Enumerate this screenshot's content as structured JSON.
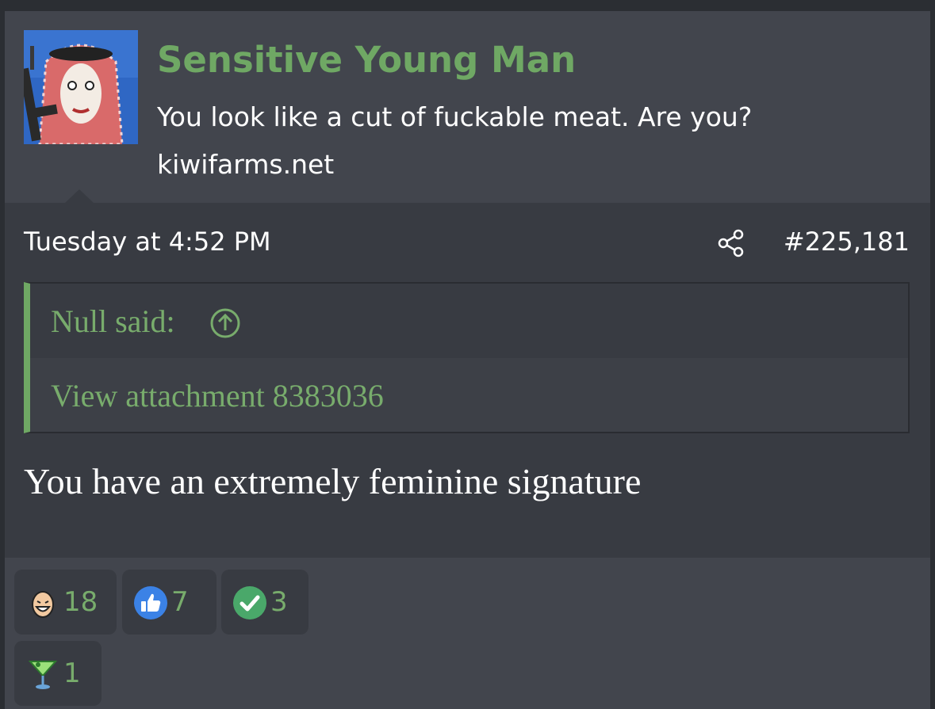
{
  "author": {
    "username": "Sensitive Young Man",
    "user_title": "You look like a cut of fuckable meat. Are you?",
    "site": "kiwifarms.net",
    "avatar_icon": "avatar-image"
  },
  "post": {
    "date": "Tuesday at 4:52 PM",
    "number": "#225,181",
    "share_icon": "share-icon",
    "quote": {
      "author_label": "Null said:",
      "arrow_icon": "arrow-up-circle-icon",
      "attachment_text": "View attachment 8383036"
    },
    "body": "You have an extremely feminine signature"
  },
  "reactions": [
    {
      "icon": "laughing-face-icon",
      "count": "18"
    },
    {
      "icon": "thumbs-up-icon",
      "count": "7"
    },
    {
      "icon": "check-mark-icon",
      "count": "3"
    },
    {
      "icon": "cocktail-glass-icon",
      "count": "1"
    }
  ],
  "colors": {
    "accent_green": "#6fa864",
    "background": "#383b42",
    "header_background": "#42454d",
    "text": "#ffffff"
  }
}
